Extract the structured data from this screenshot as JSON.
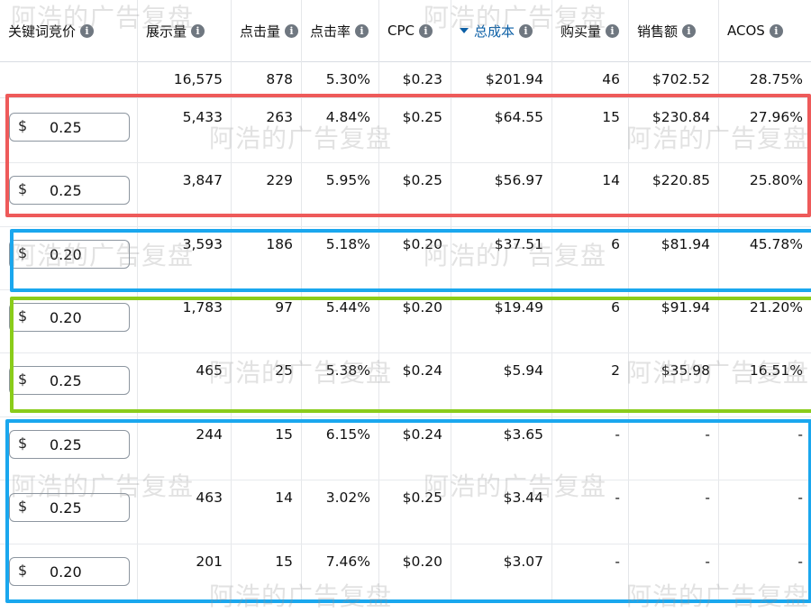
{
  "columns": [
    {
      "label": "关键词竞价",
      "icon": "info-icon"
    },
    {
      "label": "展示量",
      "icon": "info-icon"
    },
    {
      "label": "点击量",
      "icon": "info-icon"
    },
    {
      "label": "点击率",
      "icon": "info-icon"
    },
    {
      "label": "CPC",
      "icon": "info-icon"
    },
    {
      "label": "总成本",
      "icon": "info-icon",
      "sorted": "descending"
    },
    {
      "label": "购买量",
      "icon": "info-icon"
    },
    {
      "label": "销售额",
      "icon": "info-icon"
    },
    {
      "label": "ACOS",
      "icon": "info-icon"
    }
  ],
  "summary": [
    "16,575",
    "878",
    "5.30%",
    "$0.23",
    "$201.94",
    "46",
    "$702.52",
    "28.75%"
  ],
  "rows": [
    {
      "currency": "$",
      "bid": "0.25",
      "cells": [
        "5,433",
        "263",
        "4.84%",
        "$0.25",
        "$64.55",
        "15",
        "$230.84",
        "27.96%"
      ]
    },
    {
      "currency": "$",
      "bid": "0.25",
      "cells": [
        "3,847",
        "229",
        "5.95%",
        "$0.25",
        "$56.97",
        "14",
        "$220.85",
        "25.80%"
      ]
    },
    {
      "currency": "$",
      "bid": "0.20",
      "cells": [
        "3,593",
        "186",
        "5.18%",
        "$0.20",
        "$37.51",
        "6",
        "$81.94",
        "45.78%"
      ]
    },
    {
      "currency": "$",
      "bid": "0.20",
      "cells": [
        "1,783",
        "97",
        "5.44%",
        "$0.20",
        "$19.49",
        "6",
        "$91.94",
        "21.20%"
      ]
    },
    {
      "currency": "$",
      "bid": "0.25",
      "cells": [
        "465",
        "25",
        "5.38%",
        "$0.24",
        "$5.94",
        "2",
        "$35.98",
        "16.51%"
      ]
    },
    {
      "currency": "$",
      "bid": "0.25",
      "cells": [
        "244",
        "15",
        "6.15%",
        "$0.24",
        "$3.65",
        "-",
        "-",
        "-"
      ]
    },
    {
      "currency": "$",
      "bid": "0.25",
      "cells": [
        "463",
        "14",
        "3.02%",
        "$0.25",
        "$3.44",
        "-",
        "-",
        "-"
      ]
    },
    {
      "currency": "$",
      "bid": "0.20",
      "cells": [
        "201",
        "15",
        "7.46%",
        "$0.20",
        "$3.07",
        "-",
        "-",
        "-"
      ]
    }
  ],
  "highlight_groups": [
    {
      "rows": [
        0,
        1
      ],
      "color": "#ee5a5a"
    },
    {
      "rows": [
        2,
        2
      ],
      "color": "#1aa7ee"
    },
    {
      "rows": [
        3,
        4
      ],
      "color": "#8acc1a"
    },
    {
      "rows": [
        5,
        7
      ],
      "color": "#1aa7ee"
    }
  ],
  "watermark": "阿浩的广告复盘"
}
